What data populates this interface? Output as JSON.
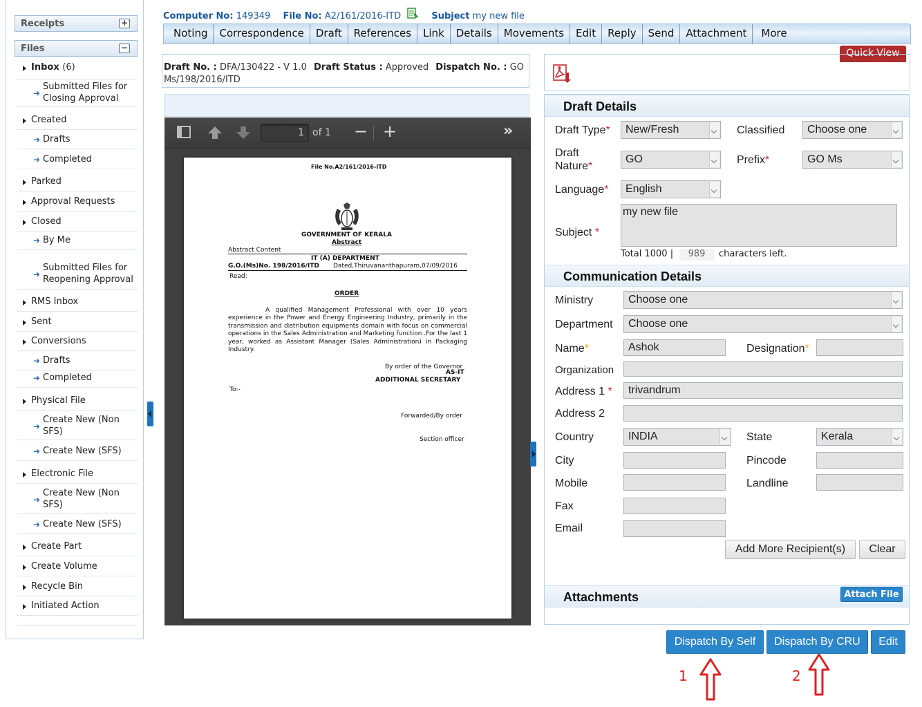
{
  "sidebar": {
    "receipts": "Receipts",
    "files": "Files",
    "items": [
      {
        "label": "Inbox",
        "count": "(6)"
      },
      {
        "label": "Submitted Files for Closing Approval"
      },
      {
        "label": "Created"
      },
      {
        "label": "Drafts"
      },
      {
        "label": "Completed"
      },
      {
        "label": "Parked"
      },
      {
        "label": "Approval Requests"
      },
      {
        "label": "Closed"
      },
      {
        "label": "By Me"
      },
      {
        "label": "Submitted Files for Reopening Approval"
      },
      {
        "label": "RMS Inbox"
      },
      {
        "label": "Sent"
      },
      {
        "label": "Conversions"
      },
      {
        "label": "Drafts"
      },
      {
        "label": "Completed"
      },
      {
        "label": "Physical File"
      },
      {
        "label": "Create New (Non SFS)"
      },
      {
        "label": "Create New (SFS)"
      },
      {
        "label": "Electronic File"
      },
      {
        "label": "Create New (Non SFS)"
      },
      {
        "label": "Create New (SFS)"
      },
      {
        "label": "Create Part"
      },
      {
        "label": "Create Volume"
      },
      {
        "label": "Recycle Bin"
      },
      {
        "label": "Initiated Action"
      }
    ]
  },
  "header": {
    "computer_no_label": "Computer No:",
    "computer_no": "149349",
    "file_no_label": "File No:",
    "file_no": "A2/161/2016-ITD",
    "subject_label": "Subject",
    "subject": "my new file"
  },
  "menu": [
    "Noting",
    "Correspondence",
    "Draft",
    "References",
    "Link",
    "Details",
    "Movements",
    "Edit",
    "Reply",
    "Send",
    "Attachment",
    "More"
  ],
  "draft_info": {
    "draft_no_label": "Draft No. :",
    "draft_no": "DFA/130422 - V 1.0",
    "status_label": "Draft Status :",
    "status": "Approved",
    "dispatch_label": "Dispatch No. :",
    "dispatch_no": "GO Ms/198/2016/ITD"
  },
  "pdf": {
    "page": "1",
    "of": "of 1",
    "file_no": "File No.A2/161/2016-ITD",
    "govt": "GOVERNMENT OF KERALA",
    "abstract": "Abstract",
    "abstract_content": "Abstract Content",
    "dept": "IT (A) DEPARTMENT",
    "go_no": "G.O.(Ms)No. 198/2016/ITD",
    "dated": "Dated,Thiruvananthapuram,07/09/2016",
    "read": "Read:",
    "order": "ORDER",
    "body": "A qualified Management Professional with over 10 years experience in the Power and Energy Engineering Industry, primarily in the transmission and distribution equipments domain with focus on commercial operations in the Sales Administration and Marketing function .For the last 1 year, worked as Assistant Manager (Sales Administration) in Packaging Industry.",
    "by_order": "By order of the Governor",
    "as_it": "AS-IT",
    "addl_sec": "ADDITIONAL SECRETARY",
    "to": "To:-",
    "forwarded": "Forwarded/By order",
    "section_officer": "Section officer"
  },
  "quick_view": "Quick View",
  "draft_details": {
    "title": "Draft Details",
    "draft_type_label": "Draft Type",
    "draft_type": "New/Fresh",
    "classified_label": "Classified",
    "classified": "Choose one",
    "draft_nature_label1": "Draft",
    "draft_nature_label2": "Nature",
    "draft_nature": "GO",
    "prefix_label": "Prefix",
    "prefix": "GO Ms",
    "language_label": "Language",
    "language": "English",
    "subject_label": "Subject",
    "subject": "my new file",
    "total_label": "Total 1000 |",
    "chars_left_value": "989",
    "chars_left_label": "characters left."
  },
  "communication": {
    "title": "Communication Details",
    "ministry_label": "Ministry",
    "ministry": "Choose one",
    "department_label": "Department",
    "department": "Choose one",
    "name_label": "Name",
    "name": "Ashok",
    "designation_label": "Designation",
    "designation": "",
    "organization_label": "Organization",
    "organization": "",
    "address1_label": "Address 1",
    "address1": "trivandrum",
    "address2_label": "Address 2",
    "address2": "",
    "country_label": "Country",
    "country": "INDIA",
    "state_label": "State",
    "state": "Kerala",
    "city_label": "City",
    "pincode_label": "Pincode",
    "mobile_label": "Mobile",
    "landline_label": "Landline",
    "fax_label": "Fax",
    "email_label": "Email",
    "add_more": "Add More Recipient(s)",
    "clear": "Clear"
  },
  "attachments": {
    "title": "Attachments",
    "attach_file": "Attach File"
  },
  "actions": {
    "dispatch_self": "Dispatch By Self",
    "dispatch_cru": "Dispatch By CRU",
    "edit": "Edit"
  },
  "annotations": {
    "one": "1",
    "two": "2"
  }
}
